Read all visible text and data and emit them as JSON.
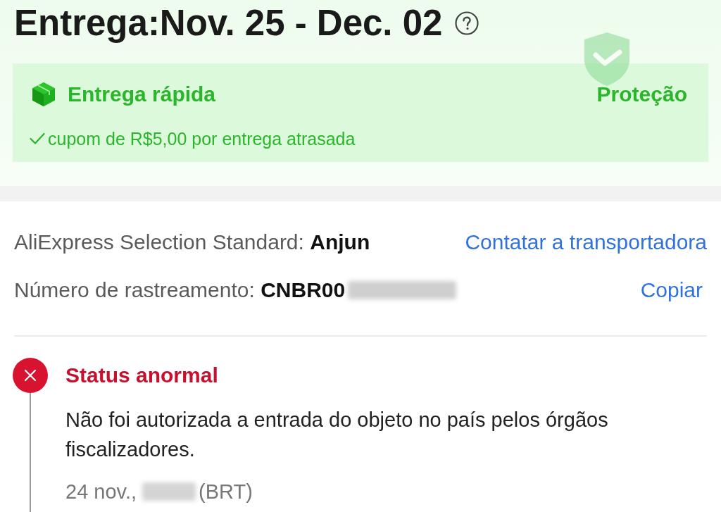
{
  "delivery": {
    "title": "Entrega:Nov. 25 - Dec. 02",
    "promise_card": {
      "title": "Entrega rápida",
      "badge": "Proteção",
      "benefit": "cupom de R$5,00 por entrega atrasada"
    }
  },
  "shipping": {
    "service": "AliExpress Selection Standard: **Anjun**",
    "contact_link": "Contatar a transportadora",
    "tracking": "Número de rastreamento: **CNBR00**",
    "copy_button": "Copiar"
  },
  "timeline": [
    {
      "kind": "error",
      "status": "Status anormal",
      "description": "Não foi autorizada a entrada do objeto no país pelos órgãos fiscalizadores.",
      "date": "24 nov.,",
      "timezone": "(BRT)"
    }
  ]
}
